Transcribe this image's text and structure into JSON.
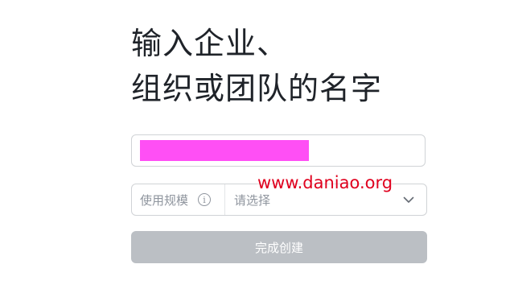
{
  "heading": {
    "line1": "输入企业、",
    "line2": "组织或团队的名字"
  },
  "name_field": {
    "value": ""
  },
  "size_select": {
    "label": "使用规模",
    "info_icon_glyph": "i",
    "placeholder": "请选择"
  },
  "submit": {
    "label": "完成创建",
    "disabled": true
  },
  "watermark": "www.daniao.org",
  "colors": {
    "submit_disabled_bg": "#bbbfc4",
    "redaction": "#ff4ff5",
    "watermark": "#e0001e"
  }
}
